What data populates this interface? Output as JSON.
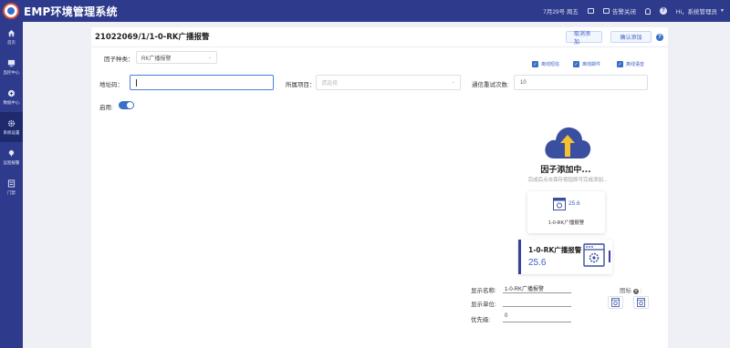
{
  "app": {
    "title": "EMP环境管理系统"
  },
  "topbar": {
    "date": "7月29号 周五",
    "close_label": "告警关闭",
    "user": "Hi，系统管理员",
    "help": "?"
  },
  "sidebar": {
    "items": [
      {
        "label": "首页",
        "icon": "home-icon"
      },
      {
        "label": "监控中心",
        "icon": "monitor-icon"
      },
      {
        "label": "数据中心",
        "icon": "data-icon"
      },
      {
        "label": "系统设置",
        "icon": "gear-icon",
        "active": true
      },
      {
        "label": "远程报警",
        "icon": "alarm-icon"
      },
      {
        "label": "门禁",
        "icon": "door-icon"
      }
    ]
  },
  "page": {
    "title": "21022069/1/1-0-RK广播报警",
    "cancel_label": "取消添加",
    "confirm_label": "确认添加",
    "help": "?"
  },
  "form": {
    "factor_type_label": "因子种类：",
    "factor_type_value": "RK广播报警",
    "checkboxes": [
      "离线短信",
      "离线邮件",
      "离线语音"
    ],
    "address_label": "地址码：",
    "project_label": "所属项目：",
    "project_placeholder": "请选择",
    "retry_label": "通信重试次数:",
    "retry_value": "10",
    "enable_label": "启用:"
  },
  "upload": {
    "title": "因子添加中...",
    "subtitle": "完成后点击保存按钮即可完成添加..."
  },
  "preview": {
    "value": "25.6",
    "name": "1-0-RK广播报警"
  },
  "wide_preview": {
    "name": "1-0-RK广播报警",
    "value": "25.6"
  },
  "display": {
    "name_label": "显示名称:",
    "name_value": "1-0-RK广播报警",
    "unit_label": "显示单位:",
    "unit_value": "",
    "priority_label": "优先级:",
    "priority_value": "0",
    "icon_label": "图标",
    "icon_help": "?"
  },
  "colors": {
    "brand": "#2e3a8c",
    "accent": "#3a6fc8"
  }
}
